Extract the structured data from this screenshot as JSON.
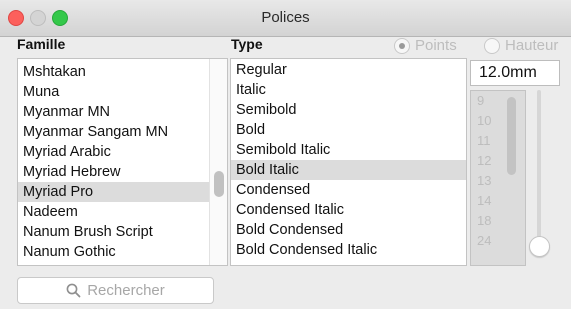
{
  "window": {
    "title": "Polices"
  },
  "columns": {
    "family": "Famille",
    "type": "Type"
  },
  "size_mode": {
    "points_label": "Points",
    "height_label": "Hauteur",
    "selected": "Points"
  },
  "families": [
    "Mshtakan",
    "Muna",
    "Myanmar MN",
    "Myanmar Sangam MN",
    "Myriad Arabic",
    "Myriad Hebrew",
    "Myriad Pro",
    "Nadeem",
    "Nanum Brush Script",
    "Nanum Gothic"
  ],
  "selected_family": "Myriad Pro",
  "types": [
    "Regular",
    "Italic",
    "Semibold",
    "Bold",
    "Semibold Italic",
    "Bold Italic",
    "Condensed",
    "Condensed Italic",
    "Bold Condensed",
    "Bold Condensed Italic"
  ],
  "selected_type": "Bold Italic",
  "size": {
    "value": "12.0mm",
    "options": [
      "9",
      "10",
      "11",
      "12",
      "13",
      "14",
      "18",
      "24"
    ]
  },
  "search": {
    "placeholder": "Rechercher"
  }
}
